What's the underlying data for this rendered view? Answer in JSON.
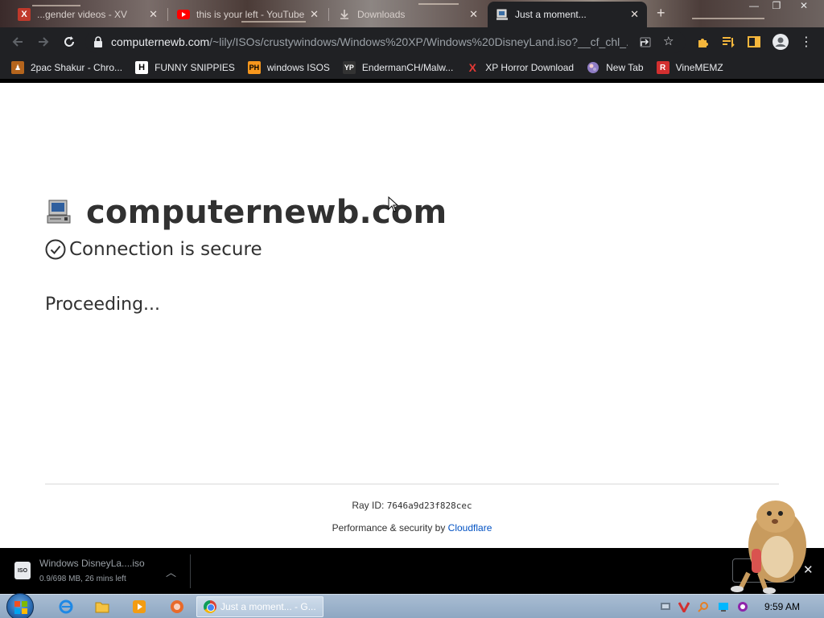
{
  "browser": {
    "tabs": [
      {
        "title": "...gender videos - XV",
        "favicon": "x-icon",
        "active": false
      },
      {
        "title": "this is your left - YouTube",
        "favicon": "youtube-icon",
        "active": false
      },
      {
        "title": "Downloads",
        "favicon": "downloads-icon",
        "active": false
      },
      {
        "title": "Just a moment...",
        "favicon": "computer-icon",
        "active": true
      }
    ],
    "new_tab_label": "+",
    "url_host": "computernewb.com",
    "url_path": "/~lily/ISOs/crustywindows/Windows%20XP/Windows%20DisneyLand.iso?__cf_chl_...",
    "bookmarks": [
      {
        "label": "2pac Shakur - Chro...",
        "icon": "pac-icon"
      },
      {
        "label": "FUNNY SNIPPIES",
        "icon": "h-icon"
      },
      {
        "label": "windows ISOS",
        "icon": "ph-icon"
      },
      {
        "label": "EndermanCH/Malw...",
        "icon": "yp-icon"
      },
      {
        "label": "XP Horror Download",
        "icon": "x-icon"
      },
      {
        "label": "New Tab",
        "icon": "globe-icon"
      },
      {
        "label": "VineMEMZ",
        "icon": "r-icon"
      }
    ]
  },
  "page": {
    "site_title": "computernewb.com",
    "secure_text": "Connection is secure",
    "proceeding_text": "Proceeding...",
    "ray_label": "Ray ID:",
    "ray_id": "7646a9d23f828cec",
    "perf_prefix": "Performance & security by",
    "perf_link": "Cloudflare"
  },
  "download": {
    "filename": "Windows DisneyLa....iso",
    "status": "0.9/698 MB, 26 mins left",
    "icon_label": "ISO"
  },
  "taskbar": {
    "task_title": "Just a moment... - G...",
    "clock": "9:59 AM"
  },
  "colors": {
    "chrome_dark": "#202124",
    "page_text": "#313131",
    "cloudflare_link": "#0051c3",
    "taskbar": "#a9bdd3"
  }
}
